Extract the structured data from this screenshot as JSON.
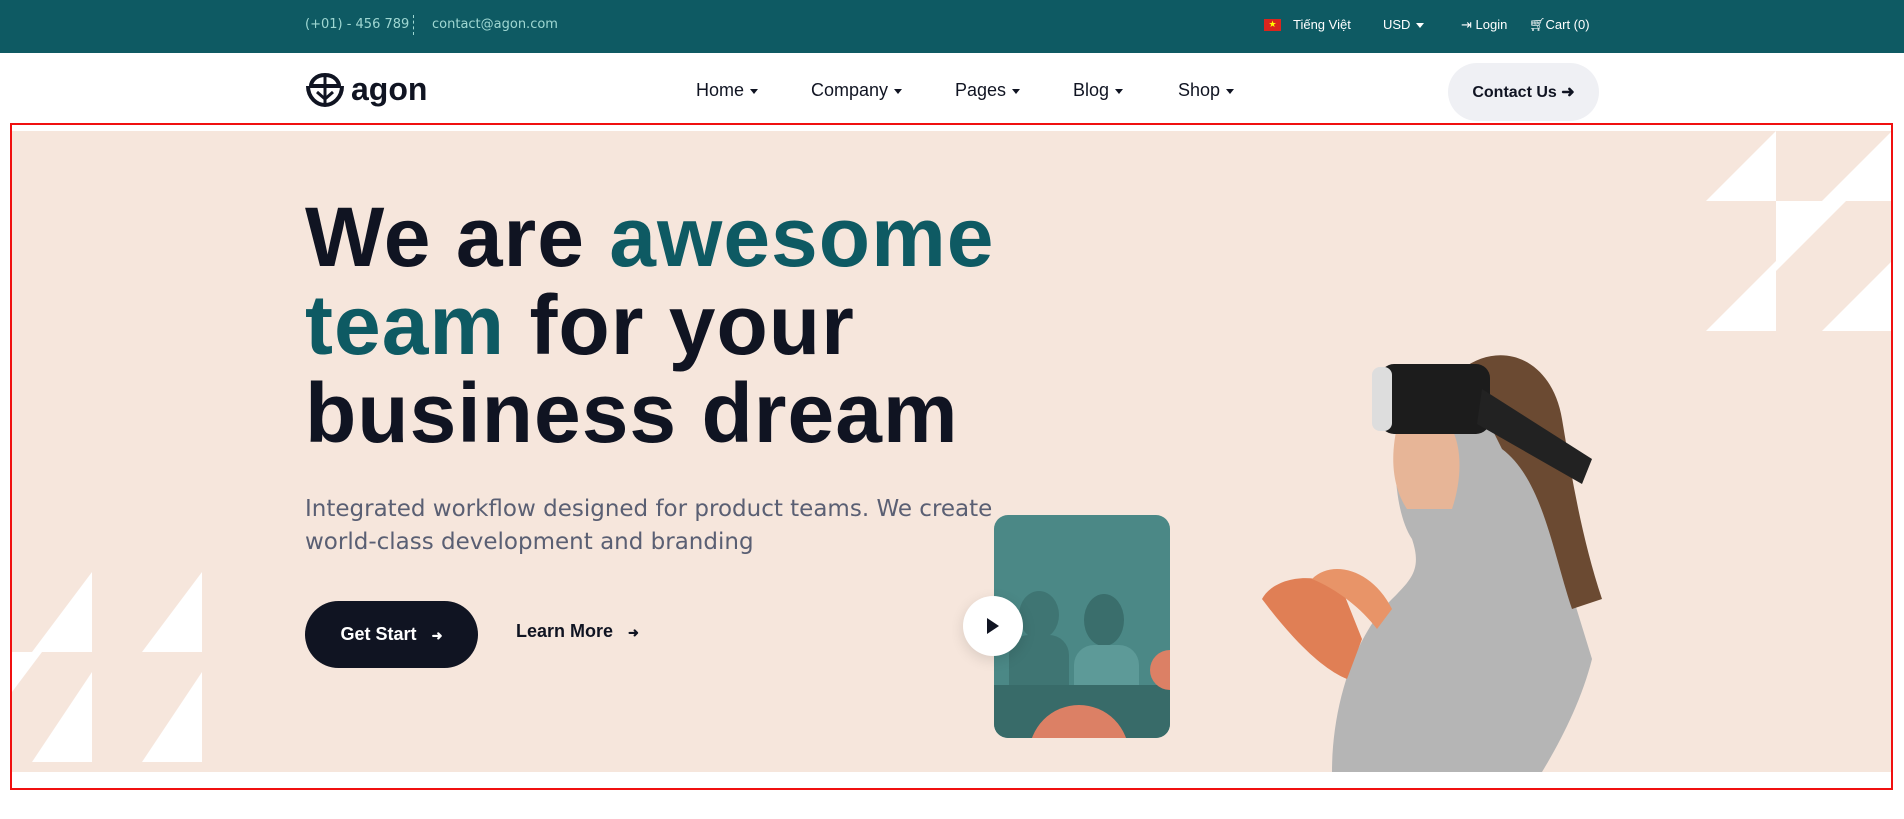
{
  "topbar": {
    "phone": "(+01) - 456 789",
    "email": "contact@agon.com",
    "language": "Tiếng Việt",
    "currency": "USD",
    "login": "Login",
    "cart": "Cart (0)"
  },
  "nav": {
    "logo": "agon",
    "items": [
      {
        "label": "Home"
      },
      {
        "label": "Company"
      },
      {
        "label": "Pages"
      },
      {
        "label": "Blog"
      },
      {
        "label": "Shop"
      }
    ],
    "contact": "Contact Us ➜"
  },
  "hero": {
    "title_1": "We are ",
    "title_accent_1": "awesome",
    "title_accent_2": "team",
    "title_2": " for your business dream",
    "description": "Integrated workflow designed for product teams. We create world-class development and branding",
    "get_start": "Get Start",
    "learn_more": "Learn More",
    "arrow": "➜"
  },
  "colors": {
    "primary": "#0e5a63",
    "dark": "#101422",
    "hero_bg": "#f6e6dc",
    "accent_orange": "#dc8065"
  }
}
